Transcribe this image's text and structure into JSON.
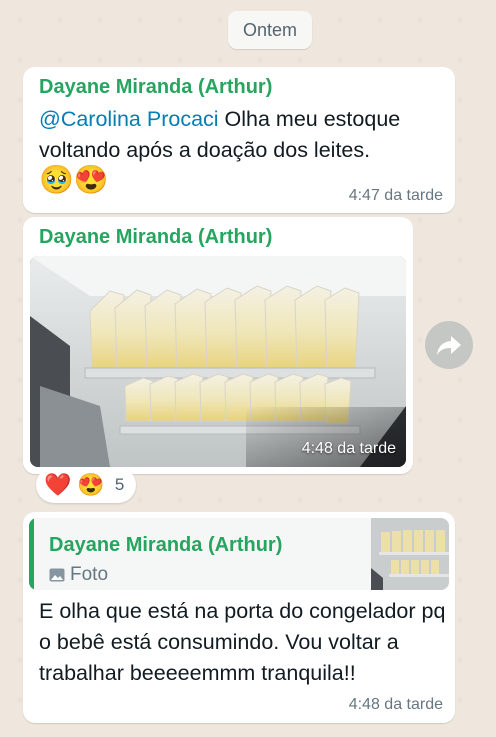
{
  "date_chip": "Ontem",
  "messages": [
    {
      "sender": "Dayane Miranda (Arthur)",
      "mention": "@Carolina Procaci",
      "text": " Olha meu estoque voltando após a doação dos leites.",
      "emojis": "🥹😍",
      "time": "4:47 da tarde"
    },
    {
      "sender": "Dayane Miranda (Arthur)",
      "time": "4:48 da tarde",
      "reactions": {
        "emojis": [
          "❤️",
          "😍"
        ],
        "count": "5"
      }
    },
    {
      "quoted_sender": "Dayane Miranda (Arthur)",
      "quoted_type": "Foto",
      "text": "E olha que está na porta do congelador pq o bebê está consumindo. Vou voltar a trabalhar beeeeemmm tranquila!!",
      "time": "4:48 da tarde"
    }
  ],
  "colors": {
    "sender": "#25a55f",
    "mention": "#027eb5",
    "background": "#efe7dd"
  },
  "icons": {
    "forward": "forward-arrow-icon",
    "photo": "image-icon"
  }
}
